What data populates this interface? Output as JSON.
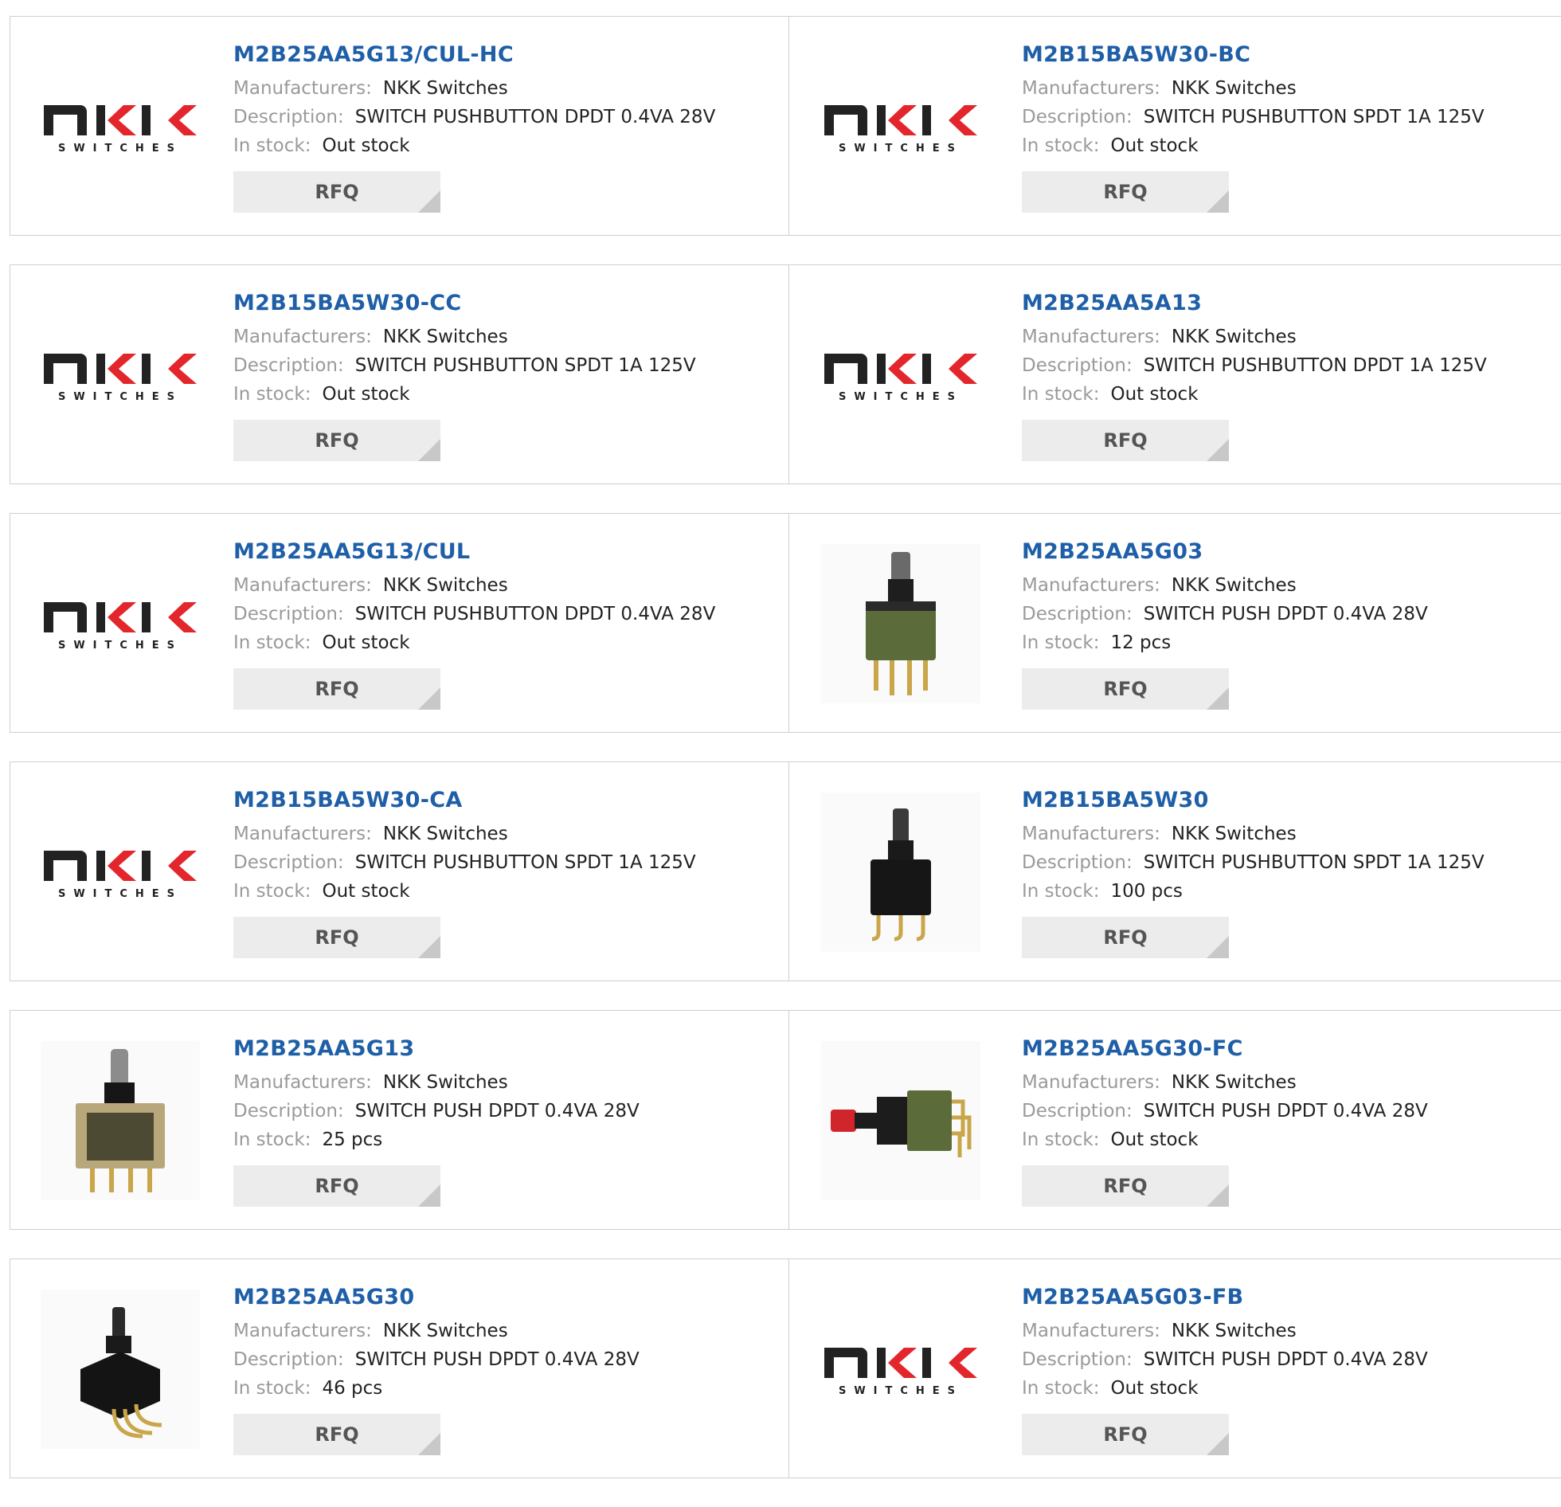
{
  "labels": {
    "manufacturers": "Manufacturers:",
    "description": "Description:",
    "in_stock": "In stock:",
    "rfq": "RFQ"
  },
  "logo": {
    "brand": "NKK",
    "sub": "SWITCHES"
  },
  "colors": {
    "title": "#1f5fa8",
    "logo_red": "#e2262b",
    "logo_dark": "#222222"
  },
  "products": [
    {
      "part": "M2B25AA5G13/CUL-HC",
      "manufacturer": "NKK Switches",
      "description": "SWITCH PUSHBUTTON DPDT 0.4VA 28V",
      "stock": "Out stock",
      "image": "nkk-logo"
    },
    {
      "part": "M2B15BA5W30-BC",
      "manufacturer": "NKK Switches",
      "description": "SWITCH PUSHBUTTON SPDT 1A 125V",
      "stock": "Out stock",
      "image": "nkk-logo"
    },
    {
      "part": "M2B15BA5W30-CC",
      "manufacturer": "NKK Switches",
      "description": "SWITCH PUSHBUTTON SPDT 1A 125V",
      "stock": "Out stock",
      "image": "nkk-logo"
    },
    {
      "part": "M2B25AA5A13",
      "manufacturer": "NKK Switches",
      "description": "SWITCH PUSHBUTTON DPDT 1A 125V",
      "stock": "Out stock",
      "image": "nkk-logo"
    },
    {
      "part": "M2B25AA5G13/CUL",
      "manufacturer": "NKK Switches",
      "description": "SWITCH PUSHBUTTON DPDT 0.4VA 28V",
      "stock": "Out stock",
      "image": "nkk-logo"
    },
    {
      "part": "M2B25AA5G03",
      "manufacturer": "NKK Switches",
      "description": "SWITCH PUSH DPDT 0.4VA 28V",
      "stock": "12 pcs",
      "image": "switch-photo-green"
    },
    {
      "part": "M2B15BA5W30-CA",
      "manufacturer": "NKK Switches",
      "description": "SWITCH PUSHBUTTON SPDT 1A 125V",
      "stock": "Out stock",
      "image": "nkk-logo"
    },
    {
      "part": "M2B15BA5W30",
      "manufacturer": "NKK Switches",
      "description": "SWITCH PUSHBUTTON SPDT 1A 125V",
      "stock": "100 pcs",
      "image": "switch-photo-black"
    },
    {
      "part": "M2B25AA5G13",
      "manufacturer": "NKK Switches",
      "description": "SWITCH PUSH DPDT 0.4VA 28V",
      "stock": "25 pcs",
      "image": "switch-photo-frame"
    },
    {
      "part": "M2B25AA5G30-FC",
      "manufacturer": "NKK Switches",
      "description": "SWITCH PUSH DPDT 0.4VA 28V",
      "stock": "Out stock",
      "image": "switch-photo-red"
    },
    {
      "part": "M2B25AA5G30",
      "manufacturer": "NKK Switches",
      "description": "SWITCH PUSH DPDT 0.4VA 28V",
      "stock": "46 pcs",
      "image": "switch-photo-angled"
    },
    {
      "part": "M2B25AA5G03-FB",
      "manufacturer": "NKK Switches",
      "description": "SWITCH PUSH DPDT 0.4VA 28V",
      "stock": "Out stock",
      "image": "nkk-logo"
    }
  ]
}
